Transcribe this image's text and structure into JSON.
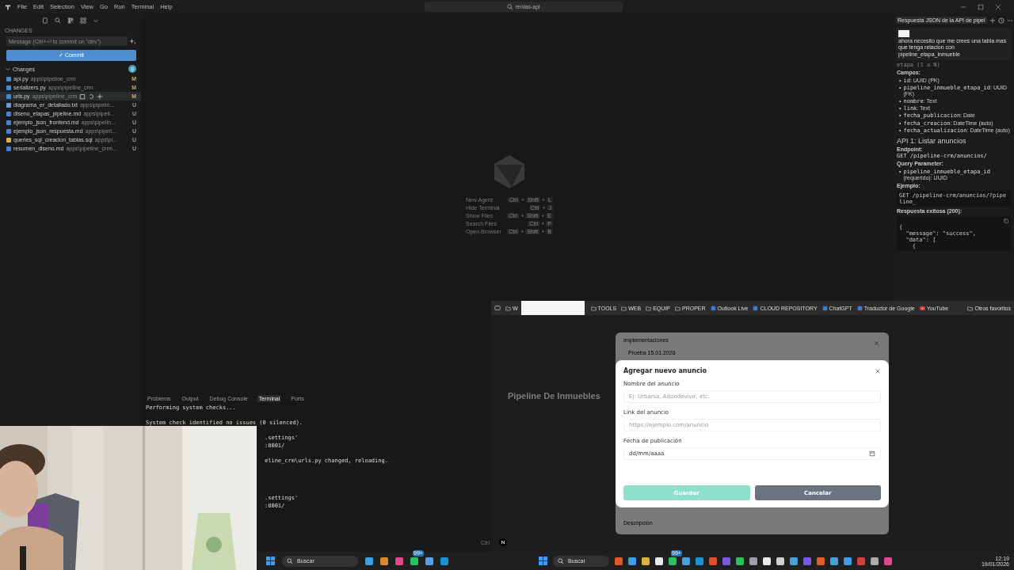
{
  "editor": {
    "menu": [
      "File",
      "Edit",
      "Selection",
      "View",
      "Go",
      "Run",
      "Terminal",
      "Help"
    ],
    "search": {
      "value": "rentas-api"
    },
    "source_control": {
      "section": "CHANGES",
      "message_placeholder": "Message (Ctrl+⏎ to commit on \"dev\")",
      "commit_button": "✓ Commit",
      "group": "Changes",
      "count": "9",
      "files": [
        {
          "name": "api.py",
          "path": "apps\\pipeline_crm",
          "status": "M",
          "kind": "py",
          "selected": false
        },
        {
          "name": "serializers.py",
          "path": "apps\\pipeline_crm",
          "status": "M",
          "kind": "py",
          "selected": false
        },
        {
          "name": "urls.py",
          "path": "apps\\pipeline_crm",
          "status": "M",
          "kind": "py",
          "selected": true
        },
        {
          "name": "diagrama_er_detallado.txt",
          "path": "apps\\pipelin...",
          "status": "U",
          "kind": "txt",
          "selected": false
        },
        {
          "name": "diseno_etapas_pipeline.md",
          "path": "apps\\pipeli...",
          "status": "U",
          "kind": "md",
          "selected": false
        },
        {
          "name": "ejemplo_json_frontend.md",
          "path": "apps\\pipelin...",
          "status": "U",
          "kind": "md",
          "selected": false
        },
        {
          "name": "ejemplo_json_respuesta.md",
          "path": "apps\\pipeli...",
          "status": "U",
          "kind": "md",
          "selected": false
        },
        {
          "name": "queries_sql_creacion_tablas.sql",
          "path": "apps\\pi...",
          "status": "U",
          "kind": "sql",
          "selected": false
        },
        {
          "name": "resumen_diseno.md",
          "path": "apps\\pipeline_crm\\...",
          "status": "U",
          "kind": "md",
          "selected": false
        }
      ]
    },
    "key_separator": "+",
    "shortcuts": [
      {
        "label": "New Agent",
        "keys": [
          "Ctrl",
          "Shift",
          "L"
        ]
      },
      {
        "label": "Hide Terminal",
        "keys": [
          "Ctrl",
          "J"
        ]
      },
      {
        "label": "Show Files",
        "keys": [
          "Ctrl",
          "Shift",
          "E"
        ]
      },
      {
        "label": "Search Files",
        "keys": [
          "Ctrl",
          "P"
        ]
      },
      {
        "label": "Open Browser",
        "keys": [
          "Ctrl",
          "Shift",
          "B"
        ]
      }
    ],
    "panel_tabs": [
      {
        "label": "Problems",
        "selected": false
      },
      {
        "label": "Output",
        "selected": false
      },
      {
        "label": "Debug Console",
        "selected": false
      },
      {
        "label": "Terminal",
        "selected": true
      },
      {
        "label": "Ports",
        "selected": false
      }
    ],
    "terminal_lines": [
      {
        "text": "Performing system checks...",
        "kind": "full"
      },
      {
        "kind": "blank"
      },
      {
        "text": "System check identified no issues (0 silenced).",
        "kind": "full"
      },
      {
        "kind": "blank"
      },
      {
        "text": ".settings'",
        "kind": "covered"
      },
      {
        "text": ":8001/",
        "kind": "covered"
      },
      {
        "kind": "blank"
      },
      {
        "text": "eline_crm\\urls.py changed, reloading.",
        "kind": "covered"
      },
      {
        "kind": "blank"
      },
      {
        "kind": "blank"
      },
      {
        "kind": "blank"
      },
      {
        "kind": "blank"
      },
      {
        "text": ".settings'",
        "kind": "covered"
      },
      {
        "text": ":8001/",
        "kind": "covered"
      }
    ],
    "status_hint": "Ctrl",
    "chat": {
      "title": "Respuesta JSON de la API de pipel",
      "user_message": "ahora necesito que me crees una tabla mas que tenga relacion con pipeline_etapa_inmueble",
      "partial_line": "etapa (1 a N)",
      "bullet": "•",
      "fields_heading": "Campos:",
      "fields": [
        {
          "code": "id",
          "text": ": UUID (PK)"
        },
        {
          "code": "pipeline_inmueble_etapa_id",
          "text": ": UUID (FK)"
        },
        {
          "code": "nombre",
          "text": ": Text"
        },
        {
          "code": "link",
          "text": ": Text"
        },
        {
          "code": "fecha_publicacion",
          "text": ": Date"
        },
        {
          "code": "fecha_creacion",
          "text": ": DateTime (auto)"
        },
        {
          "code": "fecha_actualizacion",
          "text": ": DateTime (auto)"
        }
      ],
      "api_heading": "API 1: Listar anuncios",
      "endpoint_label": "Endpoint:",
      "endpoint_code": "GET /pipeline-crm/anuncios/",
      "query_heading": "Query Parameter:",
      "query_params": [
        {
          "code": "pipeline_inmueble_etapa_id",
          "text": "(requerido): UUID"
        }
      ],
      "example_heading": "Ejemplo:",
      "example_code": "GET /pipeline-crm/anuncios/?pipeline_",
      "response_heading": "Respuesta exitosa (200):",
      "response_lines": [
        "{",
        "  \"message\": \"success\",",
        "  \"data\": [",
        "    {"
      ]
    }
  },
  "browser": {
    "bookmarks": [
      "W",
      "TOOLS",
      "WEB",
      "EQUIP",
      "PROPER",
      "Outlook Live",
      "CLOUD REPOSITORY",
      "ChatGPT",
      "Traductor de Google",
      "YouTube"
    ],
    "other_bookmarks": "Otros favoritos",
    "page_title": "Pipeline De Inmuebles",
    "behind_panel": {
      "label": "Implementaciones",
      "value": "Prueba 15.01.2026",
      "footer": "Descripción"
    },
    "modal": {
      "title": "Agregar nuevo anuncio",
      "fields": [
        {
          "label": "Nombre del anuncio",
          "placeholder": "Ej: Urbania, Adondevivir, etc.",
          "kind": "text"
        },
        {
          "label": "Link del anuncio",
          "placeholder": "https://ejemplo.com/anuncio",
          "kind": "text"
        },
        {
          "label": "Fecha de publicación",
          "value": "dd/mm/aaaa",
          "kind": "date"
        }
      ],
      "buttons": [
        {
          "label": "Guardar",
          "disabled": true,
          "kind": "primary"
        },
        {
          "label": "Cancelar",
          "disabled": false,
          "kind": "secondary"
        }
      ]
    }
  },
  "taskbars": [
    {
      "search": "Buscar",
      "badge": "99+"
    },
    {
      "search": "Buscar",
      "badge": "99+",
      "time": "12:19",
      "date": "19/01/2026"
    }
  ]
}
